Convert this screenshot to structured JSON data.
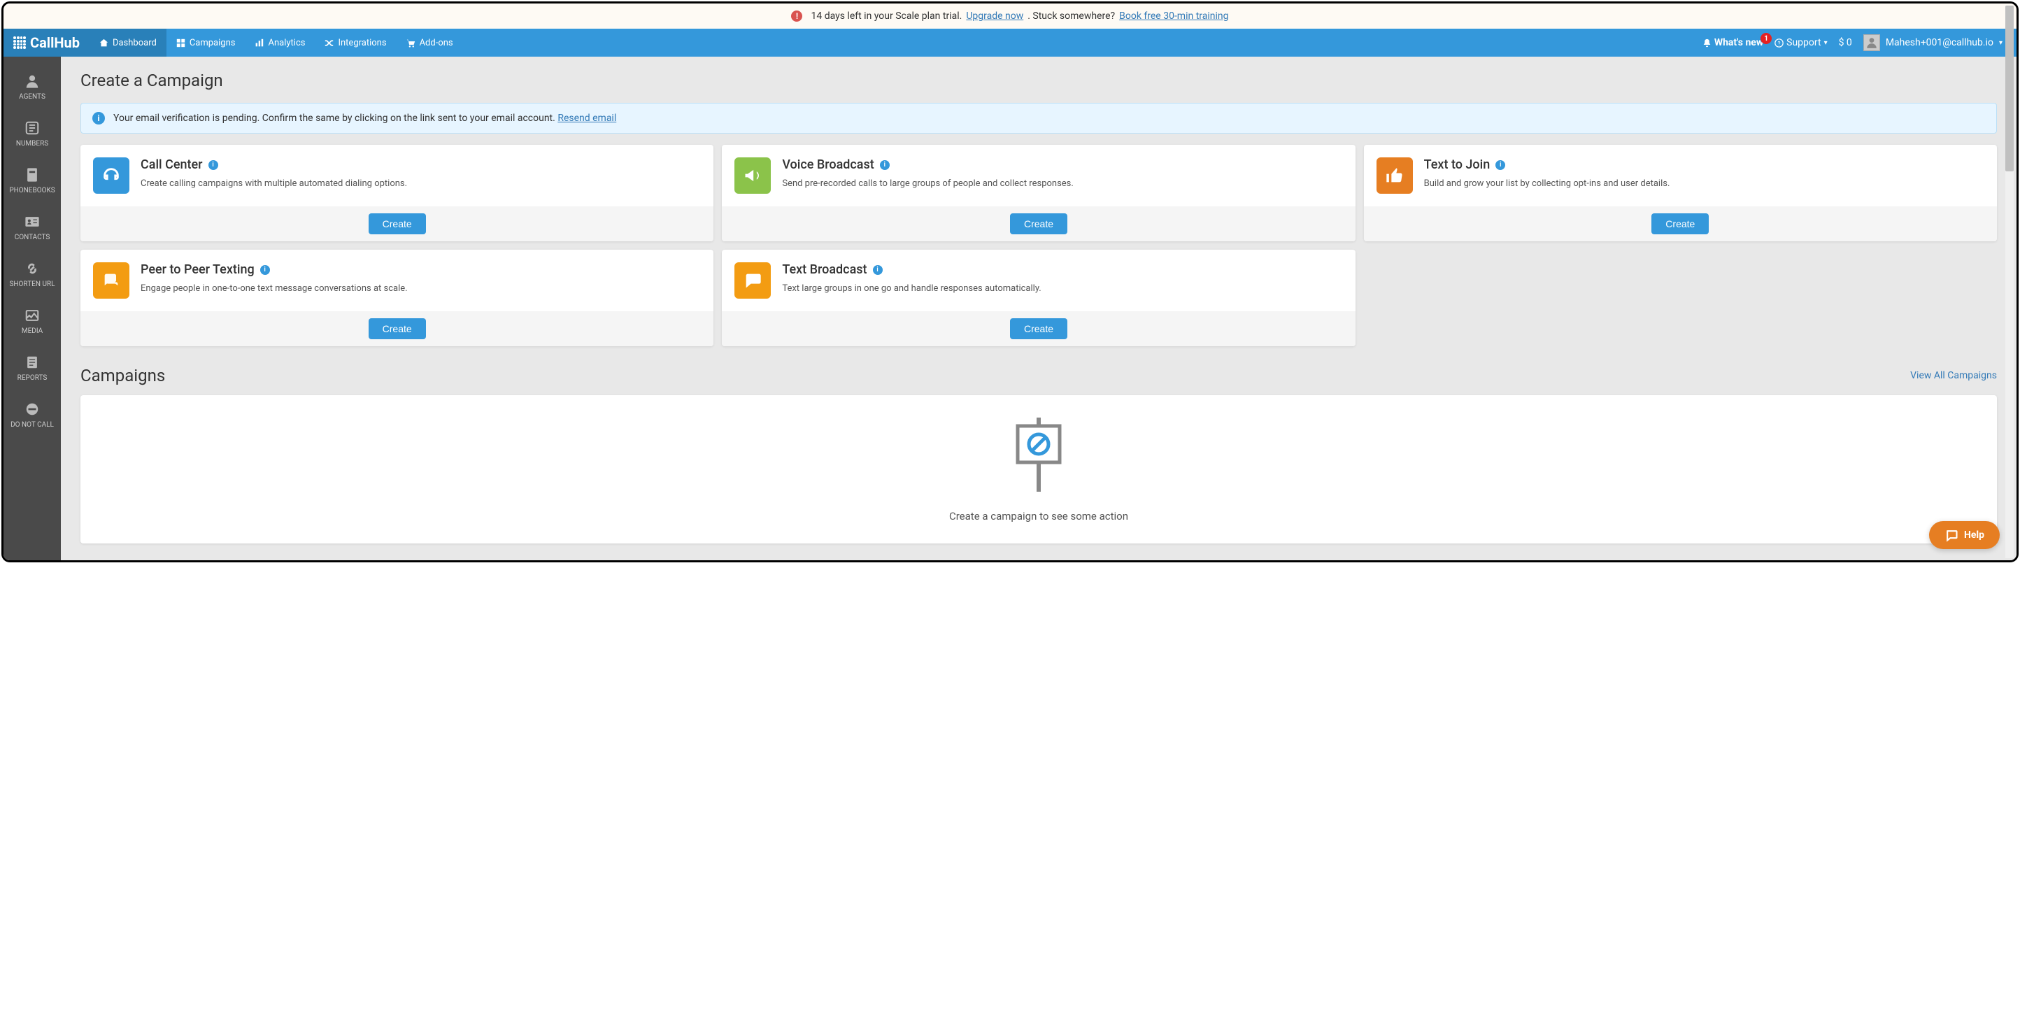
{
  "trial": {
    "days_left": "14 days left in your Scale plan trial. ",
    "upgrade": "Upgrade now",
    "stuck": ". Stuck somewhere? ",
    "training": "Book free 30-min training"
  },
  "brand": "CallHub",
  "nav": {
    "dashboard": "Dashboard",
    "campaigns": "Campaigns",
    "analytics": "Analytics",
    "integrations": "Integrations",
    "addons": "Add-ons"
  },
  "topright": {
    "whats_new": "What's new",
    "badge": "1",
    "support": "Support",
    "balance": "$ 0",
    "user": "Mahesh+001@callhub.io"
  },
  "sidebar": {
    "agents": "AGENTS",
    "numbers": "NUMBERS",
    "phonebooks": "PHONEBOOKS",
    "contacts": "CONTACTS",
    "shorten": "SHORTEN URL",
    "media": "MEDIA",
    "reports": "REPORTS",
    "dnc": "DO NOT CALL"
  },
  "page": {
    "title": "Create a Campaign",
    "banner_text": "Your email verification is pending. Confirm the same by clicking on the link sent to your email account. ",
    "resend": "Resend email"
  },
  "cards": [
    {
      "title": "Call Center",
      "desc": "Create calling campaigns with multiple automated dialing options.",
      "button": "Create"
    },
    {
      "title": "Voice Broadcast",
      "desc": "Send pre-recorded calls to large groups of people and collect responses.",
      "button": "Create"
    },
    {
      "title": "Text to Join",
      "desc": "Build and grow your list by collecting opt-ins and user details.",
      "button": "Create"
    },
    {
      "title": "Peer to Peer Texting",
      "desc": "Engage people in one-to-one text message conversations at scale.",
      "button": "Create"
    },
    {
      "title": "Text Broadcast",
      "desc": "Text large groups in one go and handle responses automatically.",
      "button": "Create"
    }
  ],
  "campaigns": {
    "heading": "Campaigns",
    "view_all": "View All Campaigns",
    "empty": "Create a campaign to see some action"
  },
  "help": "Help"
}
